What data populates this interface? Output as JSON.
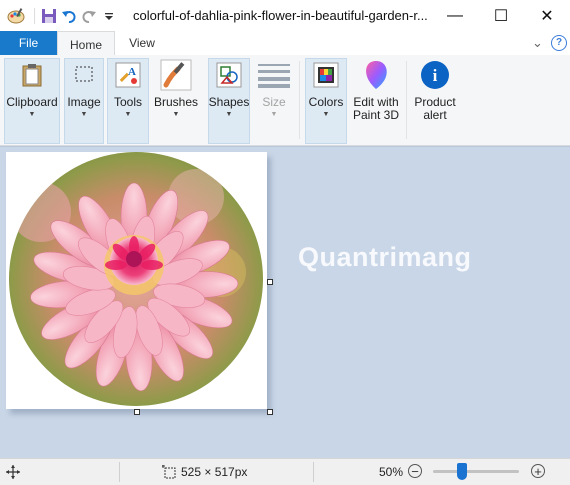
{
  "window": {
    "title": "colorful-of-dahlia-pink-flower-in-beautiful-garden-r...",
    "minimize_label": "—",
    "maximize_label": "☐",
    "close_label": "✕"
  },
  "tabs": {
    "file": "File",
    "home": "Home",
    "view": "View",
    "collapse_glyph": "⌄",
    "help_glyph": "?"
  },
  "ribbon": {
    "clipboard": "Clipboard",
    "image": "Image",
    "tools": "Tools",
    "brushes": "Brushes",
    "shapes": "Shapes",
    "size": "Size",
    "colors": "Colors",
    "edit_paint3d_line1": "Edit with",
    "edit_paint3d_line2": "Paint 3D",
    "product_alert_line1": "Product",
    "product_alert_line2": "alert",
    "caret": "▼",
    "info_glyph": "i"
  },
  "watermark": "Quantrimang",
  "status": {
    "dimensions": "525 × 517px",
    "zoom": "50%",
    "zoom_value_percent": 50,
    "zoom_minus": "−",
    "zoom_plus": "+"
  },
  "colors": {
    "file_tab": "#1979ca",
    "workspace": "#c9d6e7",
    "zoom_thumb": "#1a73d0"
  }
}
